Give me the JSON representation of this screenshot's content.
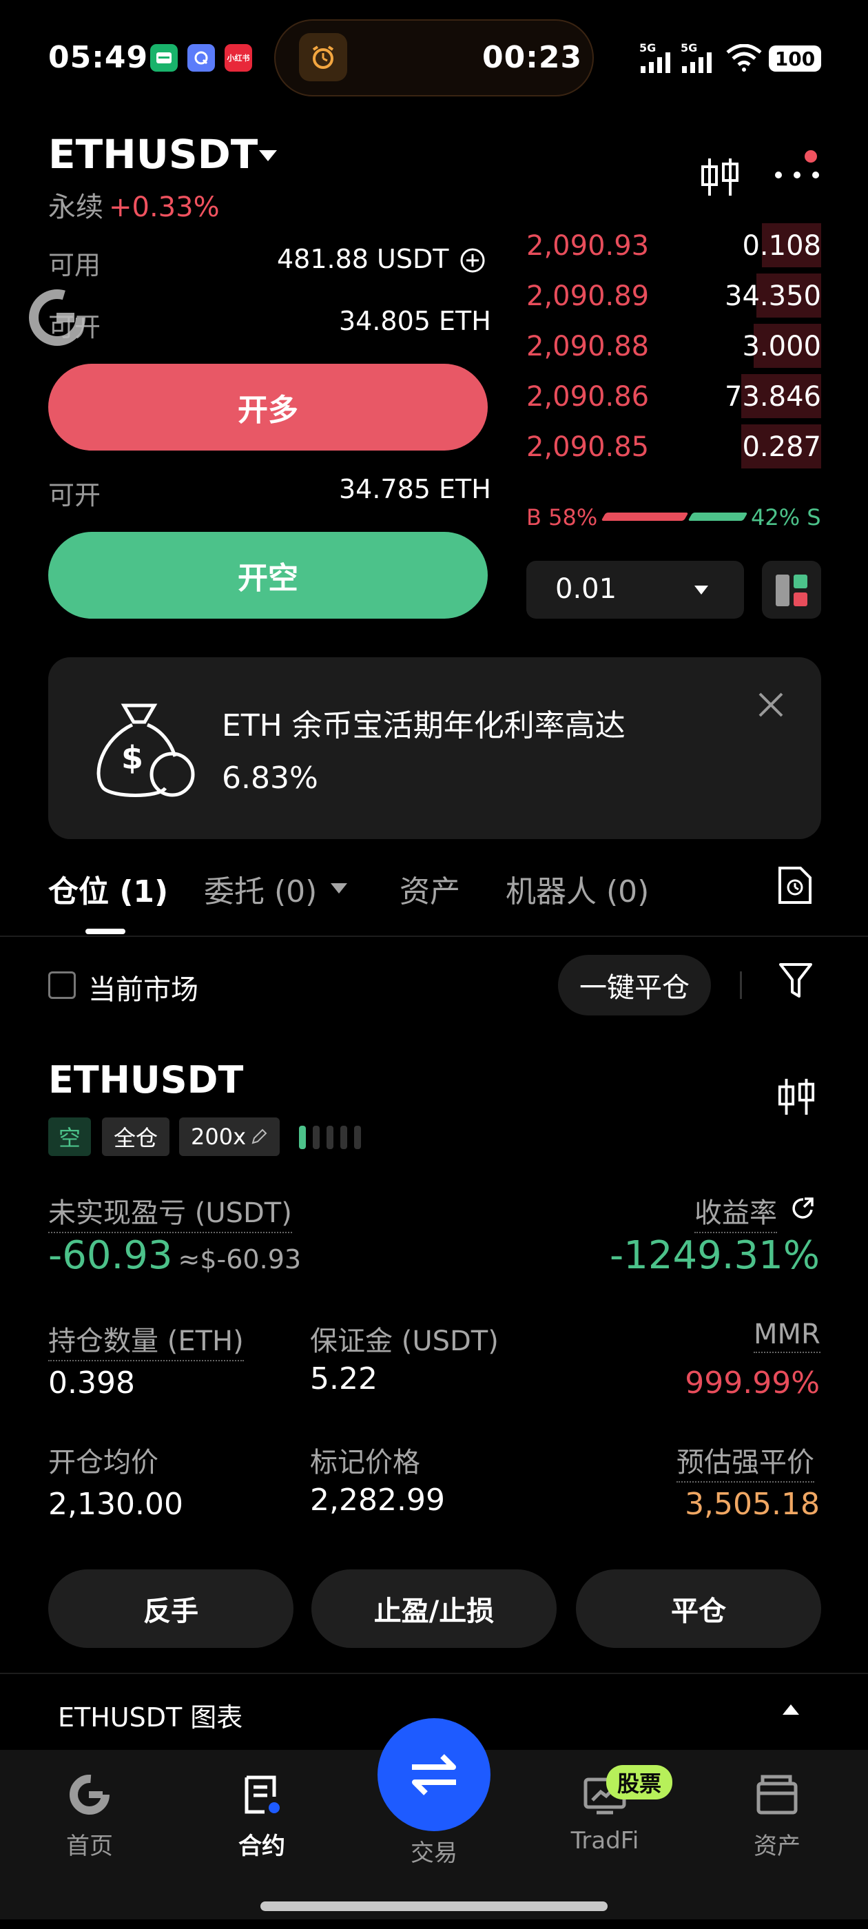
{
  "status_bar": {
    "time": "05:49",
    "apps": [
      {
        "icon": "green-app-icon",
        "color": "#19b36b"
      },
      {
        "icon": "q-app-icon",
        "color": "#5b7cfa"
      },
      {
        "icon": "red-app-icon",
        "color": "#e8283a",
        "text": "小红书"
      }
    ],
    "island_timer": "00:23",
    "island_icon": "alarm-icon",
    "network_1": "5G",
    "network_2": "5G",
    "battery": "100"
  },
  "header": {
    "symbol": "ETHUSDT",
    "type": "永续",
    "change": "+0.33%"
  },
  "order_form": {
    "available_label": "可用",
    "available_value": "481.88 USDT",
    "can_open_label_1": "可开",
    "can_open_value_1": "34.805 ETH",
    "long_button": "开多",
    "can_open_label_2": "可开",
    "can_open_value_2": "34.785 ETH",
    "short_button": "开空"
  },
  "order_book": {
    "asks": [
      {
        "price": "2,090.93",
        "qty": "0.108",
        "depth": 0.2
      },
      {
        "price": "2,090.89",
        "qty": "34.350",
        "depth": 0.22
      },
      {
        "price": "2,090.88",
        "qty": "3.000",
        "depth": 0.23
      },
      {
        "price": "2,090.86",
        "qty": "73.846",
        "depth": 0.27
      },
      {
        "price": "2,090.85",
        "qty": "0.287",
        "depth": 0.27
      }
    ],
    "buy_ratio": "B 58%",
    "sell_ratio": "42% S",
    "precision": "0.01"
  },
  "banner": {
    "line1": "ETH 余币宝活期年化利率高达",
    "line2": "6.83%"
  },
  "tabs": [
    {
      "label": "仓位 (1)",
      "active": true
    },
    {
      "label": "委托 (0)",
      "active": false
    },
    {
      "label": "资产",
      "active": false
    },
    {
      "label": "机器人 (0)",
      "active": false
    }
  ],
  "filter": {
    "current_market_label": "当前市场",
    "close_all_label": "一键平仓"
  },
  "position": {
    "symbol": "ETHUSDT",
    "side_tag": "空",
    "margin_mode_tag": "全仓",
    "leverage_tag": "200x",
    "adl_level": 1,
    "unrealized_pnl_label": "未实现盈亏 (USDT)",
    "unrealized_pnl": "-60.93",
    "unrealized_pnl_usd": "≈$-60.93",
    "roi_label": "收益率",
    "roi": "-1249.31%",
    "size_label": "持仓数量 (ETH)",
    "size": "0.398",
    "margin_label": "保证金 (USDT)",
    "margin": "5.22",
    "mmr_label": "MMR",
    "mmr": "999.99%",
    "entry_label": "开仓均价",
    "entry": "2,130.00",
    "mark_label": "标记价格",
    "mark": "2,282.99",
    "liq_label": "预估强平价",
    "liq": "3,505.18",
    "reverse_button": "反手",
    "tpsl_button": "止盈/止损",
    "close_button": "平仓"
  },
  "chart_section": {
    "label": "ETHUSDT 图表"
  },
  "bottom_nav": [
    {
      "label": "首页",
      "icon": "home-icon",
      "active": false
    },
    {
      "label": "合约",
      "icon": "futures-icon",
      "active": true
    },
    {
      "label": "交易",
      "icon": "trade-swap-icon",
      "active": false
    },
    {
      "label": "TradFi",
      "icon": "tradfi-icon",
      "active": false,
      "badge": "股票"
    },
    {
      "label": "资产",
      "icon": "wallet-icon",
      "active": false
    }
  ],
  "colors": {
    "up_red": "#e84d5b",
    "down_green": "#4cc28a",
    "long_button": "#e85866",
    "short_button": "#4cc28a",
    "liq_orange": "#f0a763",
    "accent_blue": "#1e5bff"
  }
}
